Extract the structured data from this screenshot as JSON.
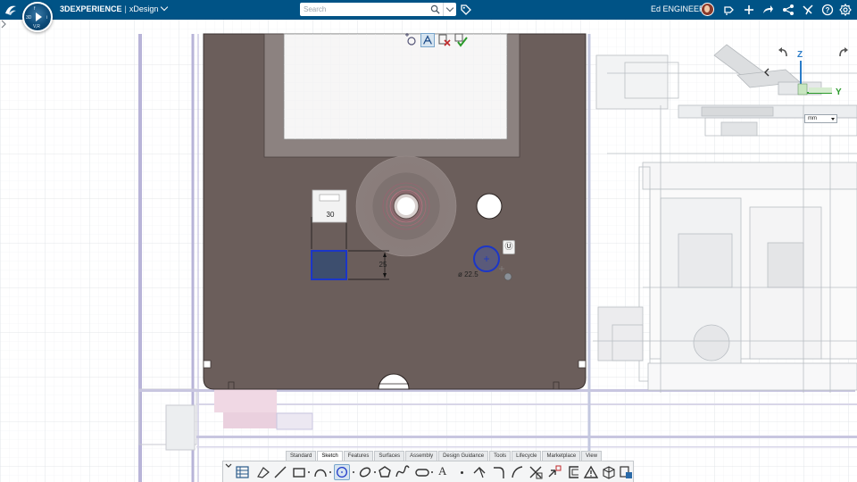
{
  "header": {
    "brand_bold": "3DEXPERIENCE",
    "separator": "|",
    "app_name": "xDesign",
    "compass_quadrants": [
      "3D",
      "V,R",
      "i",
      "f"
    ],
    "user_name": "Ed ENGINEER",
    "icons": [
      "ds-logo-icon",
      "compass-icon",
      "app-chevron-icon",
      "search-icon",
      "search-dropdown-icon",
      "tag-icon",
      "avatar",
      "share-icon",
      "plus-icon",
      "forward-icon",
      "network-icon",
      "tools-icon",
      "help-icon",
      "settings-icon"
    ]
  },
  "search": {
    "placeholder": "Search",
    "value": ""
  },
  "canvas": {
    "dimensions": {
      "width_label": "30",
      "height_label": "25",
      "diameter_label": "ø 22.5"
    },
    "units": "mm",
    "view_cube": {
      "z_label": "Z",
      "y_label": "Y"
    },
    "context_tool": "Ⓤ",
    "colors": {
      "part_fill": "#6b5e5b",
      "sketch_blue": "#1b36c8",
      "selection_fill": "#3d4e6e",
      "grid": "#e4e7ea",
      "axis_lavender": "#b8b4d8",
      "z_axis": "#2a7cc8",
      "y_axis": "#2a9a2a"
    }
  },
  "action_bar": {
    "tabs": [
      "Standard",
      "Sketch",
      "Features",
      "Surfaces",
      "Assembly",
      "Design Guidance",
      "Tools",
      "Lifecycle",
      "Marketplace",
      "View"
    ],
    "active_tab": "Sketch",
    "text_tool": "A",
    "tools": [
      "collapse-icon",
      "sketch-grid-icon",
      "construction-icon",
      "line-icon",
      "rectangle-icon",
      "arc-icon",
      "circle-icon",
      "ellipse-icon",
      "polygon-icon",
      "spline-icon",
      "slot-icon",
      "text-icon",
      "point-icon",
      "trim-icon",
      "fillet-icon",
      "chamfer-icon",
      "cut-icon",
      "transform-icon",
      "offset-icon",
      "constraint-icon",
      "project-icon",
      "3d-sketch-icon",
      "exit-sketch-icon"
    ]
  }
}
